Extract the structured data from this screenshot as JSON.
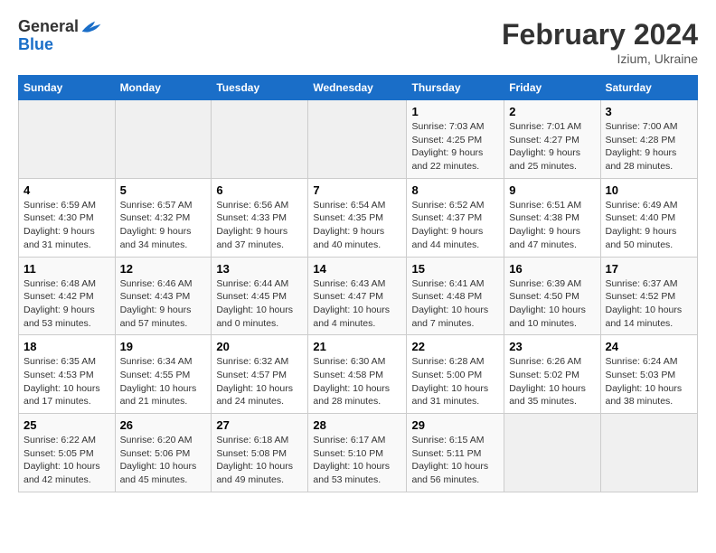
{
  "header": {
    "logo_general": "General",
    "logo_blue": "Blue",
    "title": "February 2024",
    "subtitle": "Izium, Ukraine"
  },
  "columns": [
    "Sunday",
    "Monday",
    "Tuesday",
    "Wednesday",
    "Thursday",
    "Friday",
    "Saturday"
  ],
  "weeks": [
    {
      "days": [
        {
          "num": "",
          "detail": ""
        },
        {
          "num": "",
          "detail": ""
        },
        {
          "num": "",
          "detail": ""
        },
        {
          "num": "",
          "detail": ""
        },
        {
          "num": "1",
          "detail": "Sunrise: 7:03 AM\nSunset: 4:25 PM\nDaylight: 9 hours\nand 22 minutes."
        },
        {
          "num": "2",
          "detail": "Sunrise: 7:01 AM\nSunset: 4:27 PM\nDaylight: 9 hours\nand 25 minutes."
        },
        {
          "num": "3",
          "detail": "Sunrise: 7:00 AM\nSunset: 4:28 PM\nDaylight: 9 hours\nand 28 minutes."
        }
      ]
    },
    {
      "days": [
        {
          "num": "4",
          "detail": "Sunrise: 6:59 AM\nSunset: 4:30 PM\nDaylight: 9 hours\nand 31 minutes."
        },
        {
          "num": "5",
          "detail": "Sunrise: 6:57 AM\nSunset: 4:32 PM\nDaylight: 9 hours\nand 34 minutes."
        },
        {
          "num": "6",
          "detail": "Sunrise: 6:56 AM\nSunset: 4:33 PM\nDaylight: 9 hours\nand 37 minutes."
        },
        {
          "num": "7",
          "detail": "Sunrise: 6:54 AM\nSunset: 4:35 PM\nDaylight: 9 hours\nand 40 minutes."
        },
        {
          "num": "8",
          "detail": "Sunrise: 6:52 AM\nSunset: 4:37 PM\nDaylight: 9 hours\nand 44 minutes."
        },
        {
          "num": "9",
          "detail": "Sunrise: 6:51 AM\nSunset: 4:38 PM\nDaylight: 9 hours\nand 47 minutes."
        },
        {
          "num": "10",
          "detail": "Sunrise: 6:49 AM\nSunset: 4:40 PM\nDaylight: 9 hours\nand 50 minutes."
        }
      ]
    },
    {
      "days": [
        {
          "num": "11",
          "detail": "Sunrise: 6:48 AM\nSunset: 4:42 PM\nDaylight: 9 hours\nand 53 minutes."
        },
        {
          "num": "12",
          "detail": "Sunrise: 6:46 AM\nSunset: 4:43 PM\nDaylight: 9 hours\nand 57 minutes."
        },
        {
          "num": "13",
          "detail": "Sunrise: 6:44 AM\nSunset: 4:45 PM\nDaylight: 10 hours\nand 0 minutes."
        },
        {
          "num": "14",
          "detail": "Sunrise: 6:43 AM\nSunset: 4:47 PM\nDaylight: 10 hours\nand 4 minutes."
        },
        {
          "num": "15",
          "detail": "Sunrise: 6:41 AM\nSunset: 4:48 PM\nDaylight: 10 hours\nand 7 minutes."
        },
        {
          "num": "16",
          "detail": "Sunrise: 6:39 AM\nSunset: 4:50 PM\nDaylight: 10 hours\nand 10 minutes."
        },
        {
          "num": "17",
          "detail": "Sunrise: 6:37 AM\nSunset: 4:52 PM\nDaylight: 10 hours\nand 14 minutes."
        }
      ]
    },
    {
      "days": [
        {
          "num": "18",
          "detail": "Sunrise: 6:35 AM\nSunset: 4:53 PM\nDaylight: 10 hours\nand 17 minutes."
        },
        {
          "num": "19",
          "detail": "Sunrise: 6:34 AM\nSunset: 4:55 PM\nDaylight: 10 hours\nand 21 minutes."
        },
        {
          "num": "20",
          "detail": "Sunrise: 6:32 AM\nSunset: 4:57 PM\nDaylight: 10 hours\nand 24 minutes."
        },
        {
          "num": "21",
          "detail": "Sunrise: 6:30 AM\nSunset: 4:58 PM\nDaylight: 10 hours\nand 28 minutes."
        },
        {
          "num": "22",
          "detail": "Sunrise: 6:28 AM\nSunset: 5:00 PM\nDaylight: 10 hours\nand 31 minutes."
        },
        {
          "num": "23",
          "detail": "Sunrise: 6:26 AM\nSunset: 5:02 PM\nDaylight: 10 hours\nand 35 minutes."
        },
        {
          "num": "24",
          "detail": "Sunrise: 6:24 AM\nSunset: 5:03 PM\nDaylight: 10 hours\nand 38 minutes."
        }
      ]
    },
    {
      "days": [
        {
          "num": "25",
          "detail": "Sunrise: 6:22 AM\nSunset: 5:05 PM\nDaylight: 10 hours\nand 42 minutes."
        },
        {
          "num": "26",
          "detail": "Sunrise: 6:20 AM\nSunset: 5:06 PM\nDaylight: 10 hours\nand 45 minutes."
        },
        {
          "num": "27",
          "detail": "Sunrise: 6:18 AM\nSunset: 5:08 PM\nDaylight: 10 hours\nand 49 minutes."
        },
        {
          "num": "28",
          "detail": "Sunrise: 6:17 AM\nSunset: 5:10 PM\nDaylight: 10 hours\nand 53 minutes."
        },
        {
          "num": "29",
          "detail": "Sunrise: 6:15 AM\nSunset: 5:11 PM\nDaylight: 10 hours\nand 56 minutes."
        },
        {
          "num": "",
          "detail": ""
        },
        {
          "num": "",
          "detail": ""
        }
      ]
    }
  ]
}
